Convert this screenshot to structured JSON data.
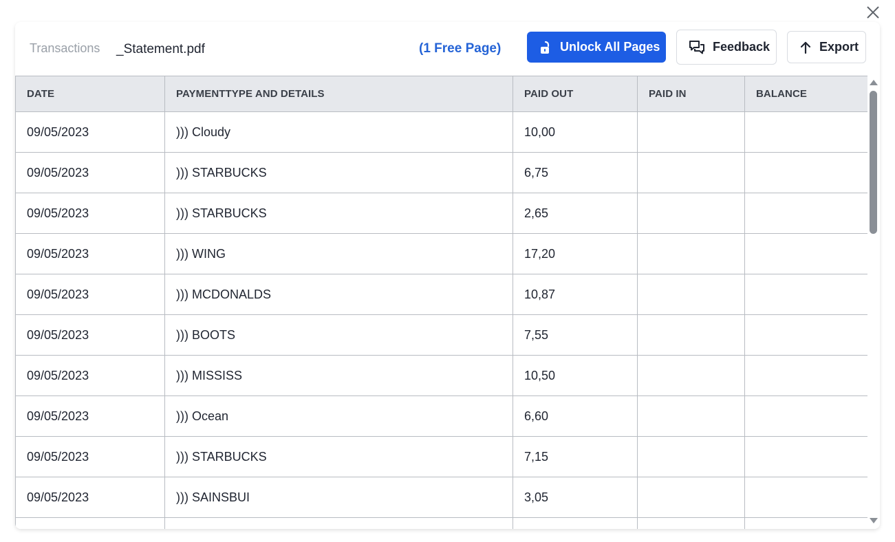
{
  "header": {
    "breadcrumb_root": "Transactions",
    "file_name": "_Statement.pdf",
    "free_page_note": "(1 Free Page)",
    "unlock_label": "Unlock All Pages",
    "feedback_label": "Feedback",
    "export_label": "Export"
  },
  "colors": {
    "accent": "#1d5de4",
    "link": "#2463d6",
    "header_bg": "#e6e8ec"
  },
  "icons": {
    "close": "close-icon",
    "unlock": "unlock-icon",
    "feedback": "chat-bubbles-icon",
    "export": "arrow-up-icon"
  },
  "table": {
    "columns": [
      "DATE",
      "PAYMENTTYPE AND DETAILS",
      "PAID OUT",
      "PAID IN",
      "BALANCE"
    ],
    "rows": [
      {
        "date": "09/05/2023",
        "details": "))) Cloudy",
        "paid_out": "10,00",
        "paid_in": "",
        "balance": ""
      },
      {
        "date": "09/05/2023",
        "details": "))) STARBUCKS",
        "paid_out": "6,75",
        "paid_in": "",
        "balance": ""
      },
      {
        "date": "09/05/2023",
        "details": "))) STARBUCKS",
        "paid_out": "2,65",
        "paid_in": "",
        "balance": ""
      },
      {
        "date": "09/05/2023",
        "details": "))) WING",
        "paid_out": "17,20",
        "paid_in": "",
        "balance": ""
      },
      {
        "date": "09/05/2023",
        "details": "))) MCDONALDS",
        "paid_out": "10,87",
        "paid_in": "",
        "balance": ""
      },
      {
        "date": "09/05/2023",
        "details": "))) BOOTS",
        "paid_out": "7,55",
        "paid_in": "",
        "balance": ""
      },
      {
        "date": "09/05/2023",
        "details": "))) MISSISS",
        "paid_out": "10,50",
        "paid_in": "",
        "balance": ""
      },
      {
        "date": "09/05/2023",
        "details": "))) Ocean",
        "paid_out": "6,60",
        "paid_in": "",
        "balance": ""
      },
      {
        "date": "09/05/2023",
        "details": "))) STARBUCKS",
        "paid_out": "7,15",
        "paid_in": "",
        "balance": ""
      },
      {
        "date": "09/05/2023",
        "details": "))) SAINSBUI",
        "paid_out": "3,05",
        "paid_in": "",
        "balance": ""
      },
      {
        "date": "",
        "details": "",
        "paid_out": "",
        "paid_in": "",
        "balance": ""
      }
    ]
  }
}
